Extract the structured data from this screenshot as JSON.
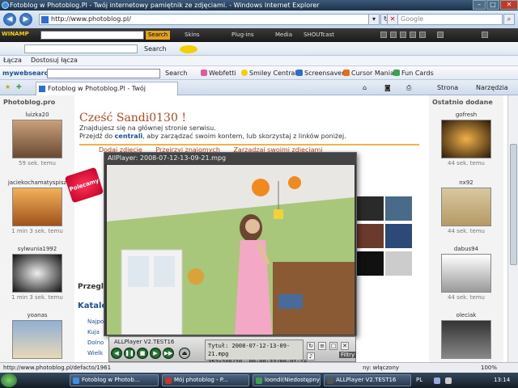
{
  "window": {
    "title": "Fotoblog w Photoblog.Pl - Twój internetowy pamiętnik ze zdjęciami. - Windows Internet Explorer",
    "controls": [
      "–",
      "□",
      "✕"
    ]
  },
  "address": {
    "url": "http://www.photoblog.pl/",
    "search_placeholder": "Google"
  },
  "winamp": {
    "brand": "WINAMP",
    "search_label": "Search",
    "menus": [
      "Skins",
      "Plug-ins",
      "Media",
      "SHOUTcast"
    ]
  },
  "toolbar3": {
    "search_label": "Search"
  },
  "links_bar": {
    "items": [
      "Łącza",
      "Dostosuj łącza"
    ]
  },
  "mywebsearch": {
    "brand": "mywebsearch",
    "search_label": "Search",
    "items": [
      "Webfetti",
      "Smiley Central",
      "Screensavers",
      "Cursor Mania",
      "Fun Cards"
    ]
  },
  "tab": {
    "title": "Fotoblog w Photoblog.Pl - Twój internetowy pa...",
    "tools": [
      "Strona",
      "Narzędzia"
    ]
  },
  "page": {
    "left_title": "Photoblog.pro",
    "right_title": "Ostatnio dodane",
    "greeting": "Cześć Sandi0130 !",
    "line1": "Znajdujesz się na głównej stronie serwisu.",
    "line2_pre": "Przejdź do",
    "line2_link": "centrali",
    "line2_post": ", aby zarządzać swoim kontem, lub skorzystaj z linków poniżej.",
    "quick_links": [
      "Dodaj zdjęcie",
      "Przejrzyj znajomych",
      "Zarządzaj swoimi zdjęciami"
    ],
    "badge": "Polecamy",
    "przegla": "Przegla",
    "katalog": "Katalo",
    "katalog_items": [
      "Najpopu",
      "Kuja",
      "Dolno",
      "Wielk"
    ],
    "left_users": [
      {
        "name": "luizka20",
        "meta": "59 sek. temu"
      },
      {
        "name": "jaciekochamatyspisz",
        "meta": "1 min 3 sek. temu"
      },
      {
        "name": "sylwunia1992",
        "meta": "1 min 3 sek. temu"
      },
      {
        "name": "yoanas",
        "meta": ""
      }
    ],
    "right_users": [
      {
        "name": "gofresh",
        "meta": "44 sek. temu"
      },
      {
        "name": "nx92",
        "meta": "44 sek. temu"
      },
      {
        "name": "dabus94",
        "meta": "44 sek. temu"
      },
      {
        "name": "oleciak",
        "meta": ""
      }
    ]
  },
  "player": {
    "title": "AllPlayer: 2008-07-12-13-09-21.mpg",
    "name": "ALLPlayer V2.TEST16",
    "lcd_title": "Tytuł:   2008-07-12-13-09-21.mpg",
    "lcd_res": "352x240/10",
    "lcd_time": "00:00:33/00:01:18",
    "filters": "Filtry"
  },
  "statusbar": {
    "url": "http://www.photoblog.pl/defacto/1961",
    "mode": "ny: włączony",
    "zoom": "100%"
  },
  "taskbar": {
    "tasks": [
      "Fotoblog w Photob...",
      "Mój photoblog - P...",
      "loondi(Niedostępny)",
      "ALLPlayer V2.TEST16"
    ],
    "lang": "PL",
    "clock": "13:14"
  }
}
